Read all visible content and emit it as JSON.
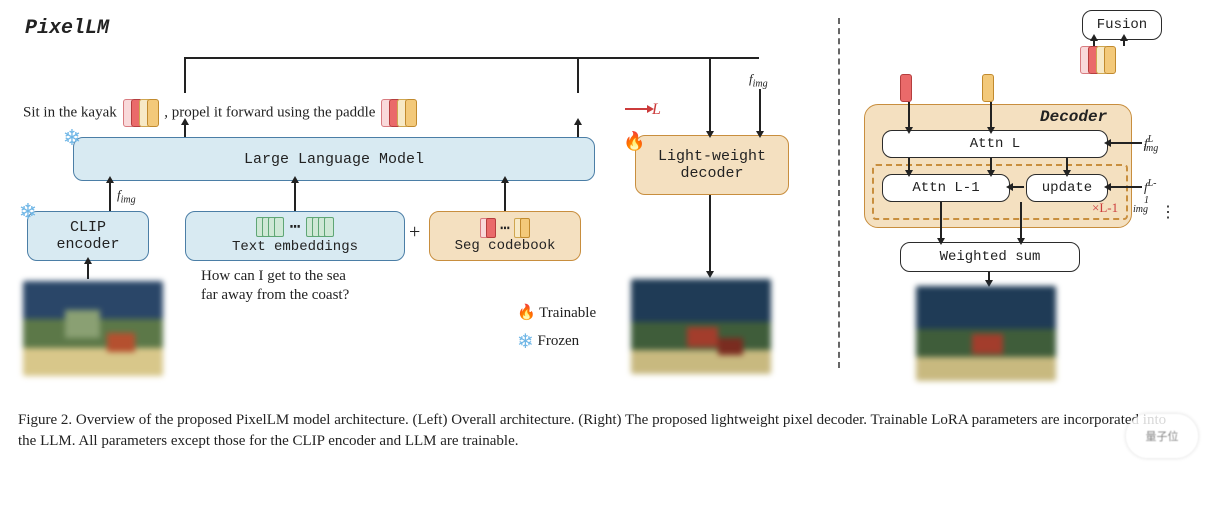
{
  "title": "PixelLM",
  "output_sentence": {
    "part1": "Sit in the kayak",
    "part2": ", propel it forward using the paddle"
  },
  "loss_symbol": "L",
  "llm_label": "Large Language Model",
  "decoder_label": "Light-weight\ndecoder",
  "clip_label": "CLIP\nencoder",
  "text_emb_label": "Text embeddings",
  "seg_label": "Seg codebook",
  "plus": "+",
  "question": "How can I get to the sea\nfar away from the coast?",
  "fimg": "f",
  "fimg_sub": "img",
  "legend": {
    "trainable": "Trainable",
    "frozen": "Frozen"
  },
  "right": {
    "fusion": "Fusion",
    "decoder_title": "Decoder",
    "attnL": "Attn L",
    "attnLm1": "Attn L-1",
    "update": "update",
    "weighted": "Weighted sum",
    "fL": {
      "f": "f",
      "sub": "img",
      "sup": "L"
    },
    "fLm1": {
      "f": "f",
      "sub": "img",
      "sup": "L-1"
    },
    "xL": "×L-1"
  },
  "caption": "Figure 2.  Overview of the proposed PixelLM model architecture.  (Left) Overall architecture.  (Right) The proposed lightweight pixel decoder.  Trainable LoRA parameters are incorporated into the LLM. All parameters except those for the CLIP encoder and LLM are trainable.",
  "watermark": "量子位"
}
